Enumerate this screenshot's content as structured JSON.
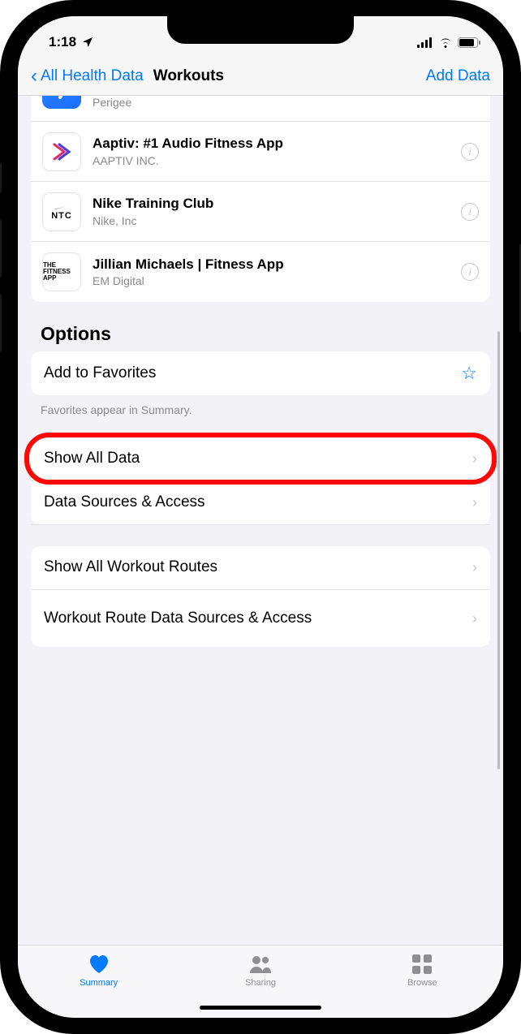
{
  "status": {
    "time": "1:18"
  },
  "nav": {
    "back_label": "All Health Data",
    "title": "Workouts",
    "action": "Add Data"
  },
  "apps": [
    {
      "name": "",
      "publisher": "Perigee",
      "icon_style": "blue"
    },
    {
      "name": "Aaptiv: #1 Audio Fitness App",
      "publisher": "AAPTIV INC.",
      "icon_text": ""
    },
    {
      "name": "Nike Training Club",
      "publisher": "Nike, Inc",
      "icon_text": "NTC"
    },
    {
      "name": "Jillian Michaels | Fitness App",
      "publisher": "EM Digital",
      "icon_text": "THE FITNESS APP"
    }
  ],
  "options": {
    "heading": "Options",
    "favorites_label": "Add to Favorites",
    "favorites_footer": "Favorites appear in Summary.",
    "rows_a": [
      "Show All Data",
      "Data Sources & Access"
    ],
    "rows_b": [
      "Show All Workout Routes",
      "Workout Route Data Sources & Access"
    ]
  },
  "tabs": {
    "summary": "Summary",
    "sharing": "Sharing",
    "browse": "Browse"
  }
}
